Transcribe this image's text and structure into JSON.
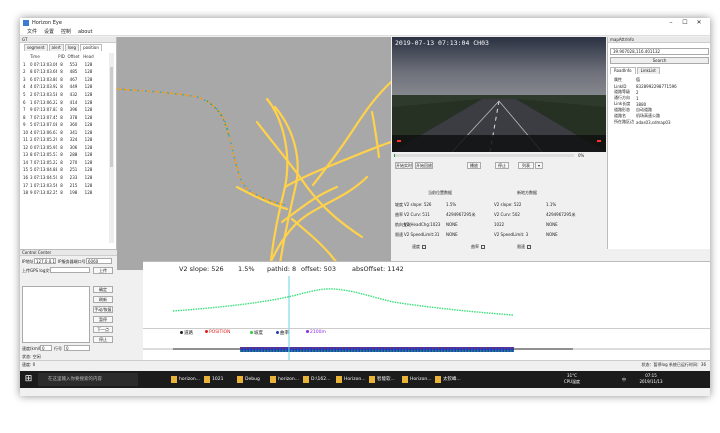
{
  "window": {
    "title": "Horizon Eye",
    "controls": [
      "–",
      "☐",
      "✕"
    ]
  },
  "menu": [
    "文件",
    "设置",
    "控制",
    "about"
  ],
  "left_panel": {
    "title": "GT",
    "tabs": [
      "segment",
      "alert",
      "Iseg",
      "position"
    ],
    "columns": [
      "",
      "Time",
      "PID",
      "Offset",
      "Head"
    ],
    "rows": [
      [
        "1",
        "0 07:13:03.065",
        "8",
        "553",
        "128"
      ],
      [
        "2",
        "8 07:13:03.665",
        "8",
        "485",
        "128"
      ],
      [
        "3",
        "6 07:13:03.805",
        "8",
        "467",
        "128"
      ],
      [
        "4",
        "4 07:13:03.920",
        "8",
        "449",
        "128"
      ],
      [
        "5",
        "2 07:13:03.589",
        "8",
        "432",
        "128"
      ],
      [
        "6",
        "1 07:13:06.220",
        "8",
        "414",
        "128"
      ],
      [
        "7",
        "9 07:13:07.837",
        "8",
        "396",
        "128"
      ],
      [
        "8",
        "7 07:13:07.451",
        "8",
        "378",
        "128"
      ],
      [
        "9",
        "5 07:13:07.089",
        "8",
        "360",
        "128"
      ],
      [
        "10",
        "4 07:13:06.670",
        "8",
        "341",
        "128"
      ],
      [
        "11",
        "2 07:13:05.298",
        "8",
        "324",
        "128"
      ],
      [
        "12",
        "0 07:13:05.919",
        "8",
        "306",
        "128"
      ],
      [
        "13",
        "8 07:13:05.570",
        "8",
        "288",
        "128"
      ],
      [
        "14",
        "7 07:13:05.229",
        "8",
        "270",
        "128"
      ],
      [
        "15",
        "5 07:13:04.880",
        "8",
        "251",
        "128"
      ],
      [
        "16",
        "3 07:13:04.508",
        "8",
        "233",
        "128"
      ],
      [
        "17",
        "1 07:13:03.569",
        "8",
        "215",
        "128"
      ],
      [
        "18",
        "9 07:13:02.250",
        "8",
        "198",
        "128"
      ]
    ]
  },
  "video": {
    "timestamp": "2019-07-13 07:13:04 CH03",
    "buttons": [
      "开始实时",
      "开始回放",
      "播放",
      "停止",
      "列表",
      "▾"
    ],
    "progress_label": "0%"
  },
  "info": {
    "col_left_title": "当前位置数据",
    "col_right_title": "新地方数据",
    "rows": [
      {
        "label": "坡度",
        "left": "V2 slope: 526",
        "left2": "1.5%",
        "right": "V2 slope: 522",
        "right2": "1.1%"
      },
      {
        "label": "曲率",
        "left": "V2 Curv: 511",
        "left2": "4294967295米",
        "right": "V2 Curv: 502",
        "right2": "4294967295米"
      },
      {
        "label": "航向变化",
        "left": "V2 HeadChg:1023",
        "left2": "NONE",
        "right": "1022",
        "right2": "NONE"
      },
      {
        "label": "限速",
        "left": "V2 SpeedLimit:31",
        "left2": "NONE",
        "right": "V2 SpeedLimit: 3",
        "right2": "NONE"
      }
    ],
    "checks": [
      "速度",
      "曲率",
      "限速"
    ]
  },
  "right_panel": {
    "title": "mapAttrInfo",
    "input": "39.907028,116.401132",
    "search_label": "Search",
    "tabs": [
      "RoadInfo",
      "LinkList"
    ],
    "header_key": "属性",
    "header_value": "值",
    "items": [
      {
        "k": "LinkID",
        "v": "8328992298771596"
      },
      {
        "k": "道路等级",
        "v": "2"
      },
      {
        "k": "通行方向",
        "v": "1"
      },
      {
        "k": "Link长度",
        "v": "3880"
      },
      {
        "k": "道路形态",
        "v": "自动道路"
      },
      {
        "k": "道路名",
        "v": "机场高速公路"
      },
      {
        "k": "所在路区边",
        "v": "adas03,sdmap03"
      }
    ]
  },
  "control_center": {
    "title": "Control Center",
    "pwd_label": "IP地址IP",
    "ip": "127.0.0.1",
    "port_label": "IP服务器端口号",
    "port": "6060",
    "upload_label": "上传GPS log文件",
    "buttons": [
      "上传",
      "确定",
      "刷新",
      "手动/恢复",
      "暂停",
      "下一点",
      "停止"
    ],
    "speed_label": "速度(km/h)",
    "speed": "0",
    "row_label": "行号",
    "row": "0",
    "status1": "状态: 空闲",
    "status2": "速度: 0"
  },
  "profile": {
    "slope_text": "V2 slope: 526",
    "slope_pct": "1.5%",
    "pathid": "pathid: 8",
    "offset": "offset: 503",
    "absoffset": "absOffset: 1142",
    "legend": [
      {
        "label": "道路",
        "color": "#222222"
      },
      {
        "label": "POSITION",
        "color": "#e02020"
      },
      {
        "label": "坡度",
        "color": "#2ecc40"
      },
      {
        "label": "曲率",
        "color": "#1f3fbf"
      },
      {
        "label": "2100m",
        "color": "#8a2be2"
      }
    ]
  },
  "status_bar": {
    "left": "",
    "right": "状态：暂停log 系统已运行时间：36"
  },
  "taskbar": {
    "search_placeholder": "在这里输入你要搜索的内容",
    "items": [
      "horizon...",
      "1021",
      "Debug",
      "horizon...",
      "D:\\162...",
      "Horizon...",
      "智能软...",
      "Horizon...",
      "太钦峰..."
    ],
    "weather": "31°C",
    "weather2": "CPU温度",
    "time": "07:15",
    "date": "2019/11/13",
    "ime": "中"
  },
  "colors": {
    "track_gt": "#ff9900",
    "track_match": "#2aa8d8",
    "route": "#ffd24a",
    "profile_curve": "#39e07a",
    "marker": "#66d6e6"
  }
}
